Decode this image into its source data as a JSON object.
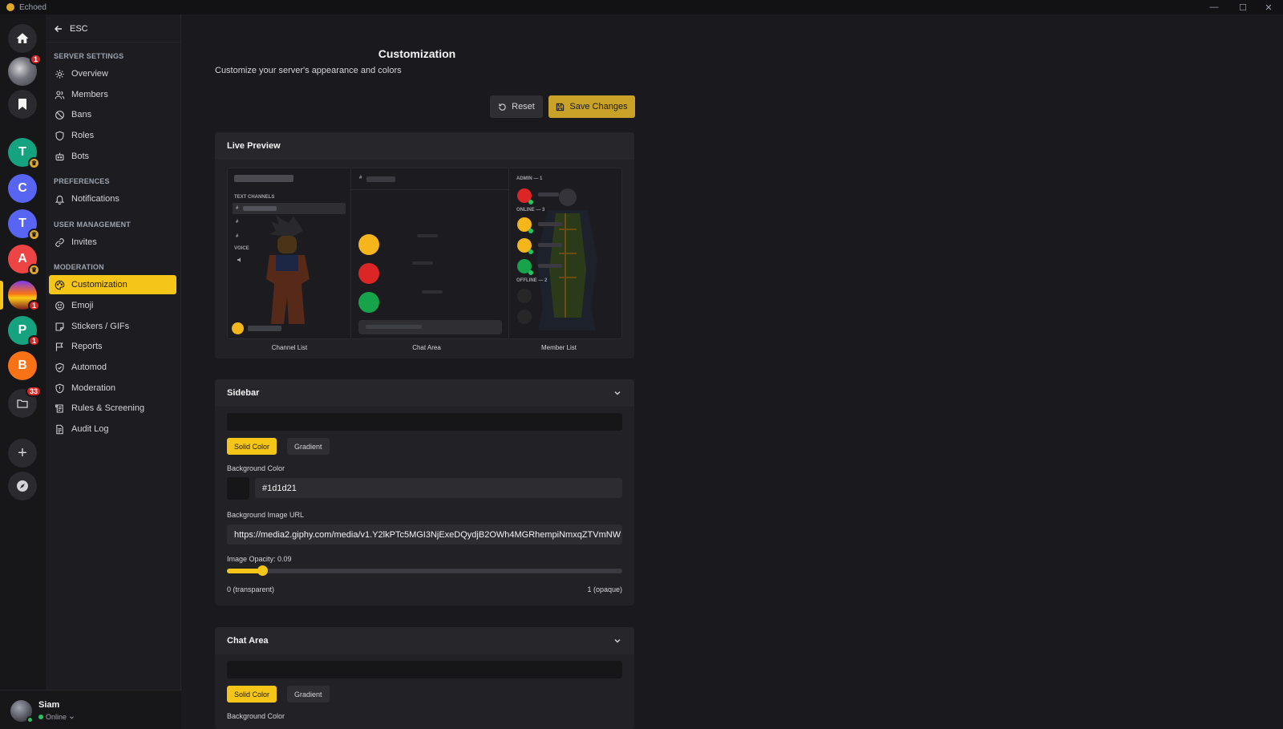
{
  "app": {
    "title": "Echoed"
  },
  "window_controls": {
    "minimize": "—",
    "maximize": "☐",
    "close": "✕"
  },
  "servers": [
    {
      "name": "home",
      "letter": ""
    },
    {
      "name": "avatar-server",
      "letter": "",
      "badge": "1"
    },
    {
      "name": "bookmarks",
      "letter": ""
    },
    {
      "name": "T",
      "letter": "T",
      "color": "#15a37f",
      "crown": true
    },
    {
      "name": "C",
      "letter": "C",
      "color": "#5865f2"
    },
    {
      "name": "T2",
      "letter": "T",
      "color": "#5865f2",
      "crown": true
    },
    {
      "name": "A",
      "letter": "A",
      "color": "#ef4444",
      "crown": true
    },
    {
      "name": "sunset-server",
      "letter": "",
      "badge": "1",
      "active": true
    },
    {
      "name": "P",
      "letter": "P",
      "color": "#15a37f",
      "badge": "1"
    },
    {
      "name": "B",
      "letter": "B",
      "color": "#f97316"
    },
    {
      "name": "folder",
      "letter": "",
      "badge": "33"
    }
  ],
  "nav": {
    "esc_label": "ESC",
    "sections": {
      "server_settings": "SERVER SETTINGS",
      "preferences": "PREFERENCES",
      "user_management": "USER MANAGEMENT",
      "moderation": "MODERATION"
    },
    "items": {
      "overview": "Overview",
      "members": "Members",
      "bans": "Bans",
      "roles": "Roles",
      "bots": "Bots",
      "notifications": "Notifications",
      "invites": "Invites",
      "customization": "Customization",
      "emoji": "Emoji",
      "stickers": "Stickers / GIFs",
      "reports": "Reports",
      "automod": "Automod",
      "moderation": "Moderation",
      "rules": "Rules & Screening",
      "audit": "Audit Log"
    }
  },
  "user": {
    "name": "Siam",
    "status": "Online"
  },
  "page": {
    "title": "Customization",
    "subtitle": "Customize your server's appearance and colors",
    "reset_label": "Reset",
    "save_label": "Save Changes"
  },
  "preview": {
    "title": "Live Preview",
    "text_channels": "TEXT CHANNELS",
    "voice": "VOICE",
    "hash": "#",
    "admin": "ADMIN — 1",
    "online": "ONLINE — 3",
    "offline": "OFFLINE — 2",
    "labels": {
      "channel_list": "Channel List",
      "chat_area": "Chat Area",
      "member_list": "Member List"
    }
  },
  "sidebar_section": {
    "title": "Sidebar",
    "solid_label": "Solid Color",
    "gradient_label": "Gradient",
    "bg_color_label": "Background Color",
    "bg_color_value": "#1d1d21",
    "bg_image_label": "Background Image URL",
    "bg_image_value": "https://media2.giphy.com/media/v1.Y2lkPTc5MGI3NjExeDQydjB2OWh4MGRhempiNmxqZTVmNW",
    "opacity_label": "Image Opacity: 0.09",
    "opacity_value": 0.09,
    "min_label": "0 (transparent)",
    "max_label": "1 (opaque)"
  },
  "chat_section": {
    "title": "Chat Area",
    "solid_label": "Solid Color",
    "gradient_label": "Gradient",
    "bg_color_label": "Background Color"
  },
  "colors": {
    "accent": "#f5c518",
    "save": "#c9a227",
    "online": "#22c55e",
    "danger": "#dc2626"
  }
}
